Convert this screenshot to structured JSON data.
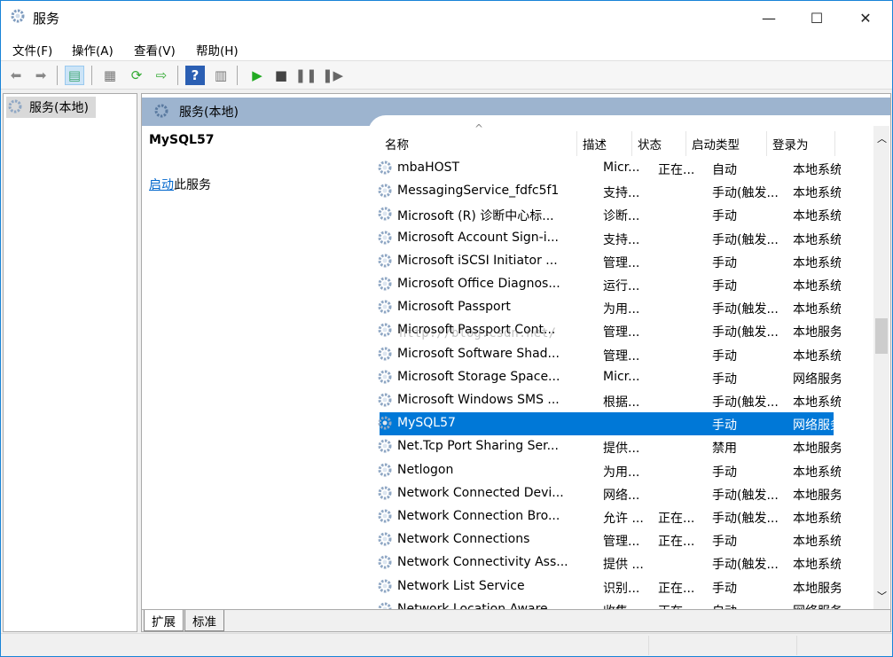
{
  "window": {
    "title": "服务",
    "minimize": "—",
    "maximize": "☐",
    "close": "✕"
  },
  "menu": [
    "文件(F)",
    "操作(A)",
    "查看(V)",
    "帮助(H)"
  ],
  "tree": {
    "root": "服务(本地)"
  },
  "panel": {
    "header": "服务(本地)",
    "selected_name": "MySQL57",
    "start_link": "启动",
    "start_suffix": "此服务"
  },
  "columns": [
    "名称",
    "描述",
    "状态",
    "启动类型",
    "登录为"
  ],
  "rows": [
    [
      "mbaHOST",
      "Micr...",
      "正在...",
      "自动",
      "本地系统"
    ],
    [
      "MessagingService_fdfc5f1",
      "支持...",
      "",
      "手动(触发...",
      "本地系统"
    ],
    [
      "Microsoft (R) 诊断中心标...",
      "诊断...",
      "",
      "手动",
      "本地系统"
    ],
    [
      "Microsoft Account Sign-i...",
      "支持...",
      "",
      "手动(触发...",
      "本地系统"
    ],
    [
      "Microsoft iSCSI Initiator ...",
      "管理...",
      "",
      "手动",
      "本地系统"
    ],
    [
      "Microsoft Office Diagnos...",
      "运行...",
      "",
      "手动",
      "本地系统"
    ],
    [
      "Microsoft Passport",
      "为用...",
      "",
      "手动(触发...",
      "本地系统"
    ],
    [
      "Microsoft Passport Cont...",
      "管理...",
      "",
      "手动(触发...",
      "本地服务"
    ],
    [
      "Microsoft Software Shad...",
      "管理...",
      "",
      "手动",
      "本地系统"
    ],
    [
      "Microsoft Storage Space...",
      "Micr...",
      "",
      "手动",
      "网络服务"
    ],
    [
      "Microsoft Windows SMS ...",
      "根据...",
      "",
      "手动(触发...",
      "本地系统"
    ],
    [
      "MySQL57",
      "",
      "",
      "手动",
      "网络服务"
    ],
    [
      "Net.Tcp Port Sharing Ser...",
      "提供...",
      "",
      "禁用",
      "本地服务"
    ],
    [
      "Netlogon",
      "为用...",
      "",
      "手动",
      "本地系统"
    ],
    [
      "Network Connected Devi...",
      "网络...",
      "",
      "手动(触发...",
      "本地服务"
    ],
    [
      "Network Connection Bro...",
      "允许 ...",
      "正在...",
      "手动(触发...",
      "本地系统"
    ],
    [
      "Network Connections",
      "管理...",
      "正在...",
      "手动",
      "本地系统"
    ],
    [
      "Network Connectivity Ass...",
      "提供 ...",
      "",
      "手动(触发...",
      "本地系统"
    ],
    [
      "Network List Service",
      "识别...",
      "正在...",
      "手动",
      "本地服务"
    ],
    [
      "Network Location Aware...",
      "收集...",
      "正在...",
      "自动",
      "网络服务"
    ]
  ],
  "selected_row": 11,
  "tabs": [
    "扩展",
    "标准"
  ],
  "watermark": "http://blog.csdn.net/",
  "colors": {
    "selection": "#0078d7",
    "panel_header": "#9db4cf",
    "link": "#0066cc"
  }
}
